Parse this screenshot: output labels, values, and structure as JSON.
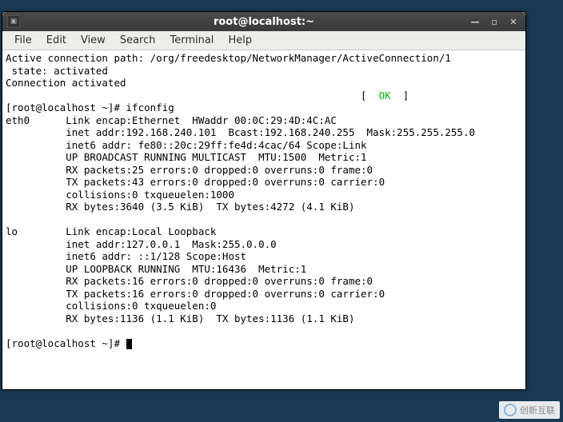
{
  "window": {
    "title": "root@localhost:~"
  },
  "menu": {
    "file": "File",
    "edit": "Edit",
    "view": "View",
    "search": "Search",
    "terminal": "Terminal",
    "help": "Help"
  },
  "terminal": {
    "line1": "Active connection path: /org/freedesktop/NetworkManager/ActiveConnection/1",
    "line2": " state: activated",
    "line3": "Connection activated",
    "ok_left": "                                                           [  ",
    "ok_text": "OK",
    "ok_right": "  ]",
    "prompt1": "[root@localhost ~]# ifconfig",
    "eth_l1": "eth0      Link encap:Ethernet  HWaddr 00:0C:29:4D:4C:AC",
    "eth_l2": "          inet addr:192.168.240.101  Bcast:192.168.240.255  Mask:255.255.255.0",
    "eth_l3": "          inet6 addr: fe80::20c:29ff:fe4d:4cac/64 Scope:Link",
    "eth_l4": "          UP BROADCAST RUNNING MULTICAST  MTU:1500  Metric:1",
    "eth_l5": "          RX packets:25 errors:0 dropped:0 overruns:0 frame:0",
    "eth_l6": "          TX packets:43 errors:0 dropped:0 overruns:0 carrier:0",
    "eth_l7": "          collisions:0 txqueuelen:1000",
    "eth_l8": "          RX bytes:3640 (3.5 KiB)  TX bytes:4272 (4.1 KiB)",
    "blank": "",
    "lo_l1": "lo        Link encap:Local Loopback",
    "lo_l2": "          inet addr:127.0.0.1  Mask:255.0.0.0",
    "lo_l3": "          inet6 addr: ::1/128 Scope:Host",
    "lo_l4": "          UP LOOPBACK RUNNING  MTU:16436  Metric:1",
    "lo_l5": "          RX packets:16 errors:0 dropped:0 overruns:0 frame:0",
    "lo_l6": "          TX packets:16 errors:0 dropped:0 overruns:0 carrier:0",
    "lo_l7": "          collisions:0 txqueuelen:0",
    "lo_l8": "          RX bytes:1136 (1.1 KiB)  TX bytes:1136 (1.1 KiB)",
    "prompt2": "[root@localhost ~]# "
  },
  "watermark": {
    "text": "创新互联"
  }
}
